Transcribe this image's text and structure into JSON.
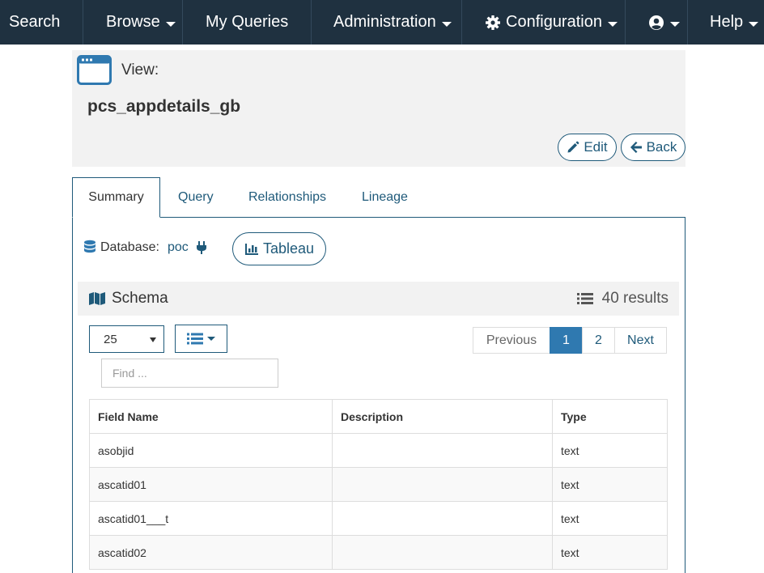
{
  "nav": {
    "search": "Search",
    "browse": "Browse",
    "my_queries": "My Queries",
    "administration": "Administration",
    "configuration": "Configuration",
    "help": "Help"
  },
  "header": {
    "view_label": "View:",
    "view_name": "pcs_appdetails_gb",
    "edit_label": "Edit",
    "back_label": "Back"
  },
  "tabs": {
    "summary": "Summary",
    "query": "Query",
    "relationships": "Relationships",
    "lineage": "Lineage"
  },
  "database": {
    "label": "Database:",
    "name": "poc",
    "tableau_label": "Tableau"
  },
  "schema": {
    "title": "Schema",
    "results": "40 results"
  },
  "controls": {
    "page_size": "25",
    "find_placeholder": "Find ...",
    "pager": {
      "previous": "Previous",
      "page1": "1",
      "page2": "2",
      "next": "Next"
    }
  },
  "table": {
    "headers": {
      "field_name": "Field Name",
      "description": "Description",
      "type": "Type"
    },
    "rows": [
      {
        "name": "asobjid",
        "description": "",
        "type": "text"
      },
      {
        "name": "ascatid01",
        "description": "",
        "type": "text"
      },
      {
        "name": "ascatid01___t",
        "description": "",
        "type": "text"
      },
      {
        "name": "ascatid02",
        "description": "",
        "type": "text"
      }
    ]
  },
  "colors": {
    "navbar": "#1f3140",
    "accent": "#1f5a7a",
    "active_page": "#2f79b0"
  }
}
